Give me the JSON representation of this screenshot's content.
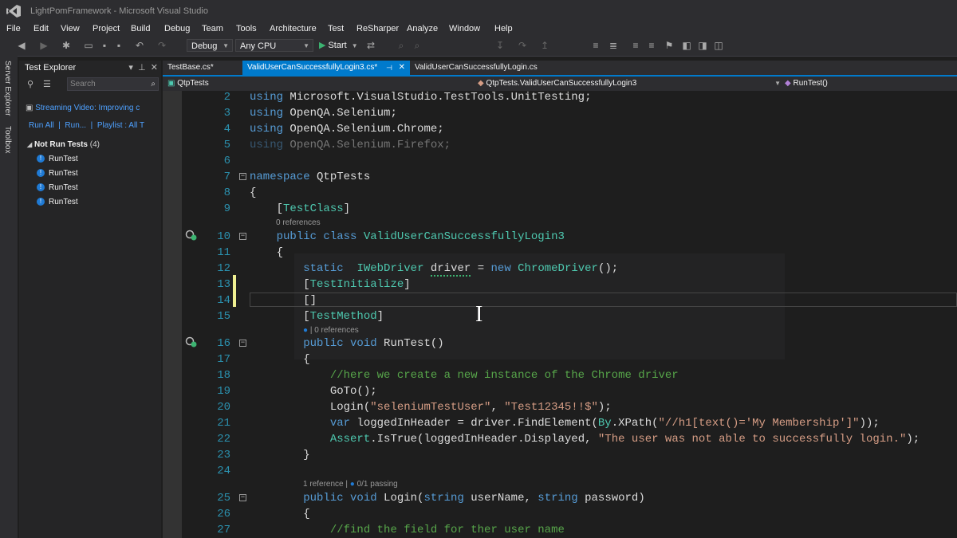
{
  "window": {
    "title": "LightPomFramework - Microsoft Visual Studio"
  },
  "menu": [
    "File",
    "Edit",
    "View",
    "Project",
    "Build",
    "Debug",
    "Team",
    "Tools",
    "Architecture",
    "Test",
    "ReSharper",
    "Analyze",
    "Window",
    "Help"
  ],
  "toolbar": {
    "configuration": "Debug",
    "platform": "Any CPU",
    "start_label": "Start"
  },
  "side_tabs": [
    "Server Explorer",
    "Toolbox"
  ],
  "test_explorer": {
    "title": "Test Explorer",
    "search_placeholder": "Search",
    "streaming": "Streaming Video: Improving c",
    "actions": {
      "run_all": "Run All",
      "run": "Run...",
      "playlist": "Playlist : All T"
    },
    "group_label": "Not Run Tests",
    "group_count": "(4)",
    "tests": [
      "RunTest",
      "RunTest",
      "RunTest",
      "RunTest"
    ]
  },
  "tabs": [
    {
      "label": "TestBase.cs*",
      "active": false
    },
    {
      "label": "ValidUserCanSuccessfullyLogin3.cs*",
      "active": true
    },
    {
      "label": "ValidUserCanSuccessfullyLogin.cs",
      "active": false
    }
  ],
  "navbar": {
    "project": "QtpTests",
    "type": "QtpTests.ValidUserCanSuccessfullyLogin3",
    "member": "RunTest()"
  },
  "lens": {
    "class_refs": "0 references",
    "method_refs": "0 references",
    "login_refs": "1 reference",
    "login_passing": "0/1 passing"
  },
  "code": [
    {
      "n": "2",
      "t": "using Microsoft.VisualStudio.TestTools.UnitTesting;"
    },
    {
      "n": "3",
      "t": "using OpenQA.Selenium;"
    },
    {
      "n": "4",
      "t": "using OpenQA.Selenium.Chrome;"
    },
    {
      "n": "5",
      "t": "using OpenQA.Selenium.Firefox;"
    },
    {
      "n": "6",
      "t": ""
    },
    {
      "n": "7",
      "t": "namespace QtpTests"
    },
    {
      "n": "8",
      "t": "{"
    },
    {
      "n": "9",
      "t": "    [TestClass]"
    },
    {
      "n": "10",
      "t": "    public class ValidUserCanSuccessfullyLogin3"
    },
    {
      "n": "11",
      "t": "    {"
    },
    {
      "n": "12",
      "t": "        static  IWebDriver driver = new ChromeDriver();"
    },
    {
      "n": "13",
      "t": "        [TestInitialize]"
    },
    {
      "n": "14",
      "t": "        []"
    },
    {
      "n": "15",
      "t": "        [TestMethod]"
    },
    {
      "n": "16",
      "t": "        public void RunTest()"
    },
    {
      "n": "17",
      "t": "        {"
    },
    {
      "n": "18",
      "t": "            //here we create a new instance of the Chrome driver"
    },
    {
      "n": "19",
      "t": "            GoTo();"
    },
    {
      "n": "20",
      "t": "            Login(\"seleniumTestUser\", \"Test12345!!$\");"
    },
    {
      "n": "21",
      "t": "            var loggedInHeader = driver.FindElement(By.XPath(\"//h1[text()='My Membership']\"));"
    },
    {
      "n": "22",
      "t": "            Assert.IsTrue(loggedInHeader.Displayed, \"The user was not able to successfully login.\");"
    },
    {
      "n": "23",
      "t": "        }"
    },
    {
      "n": "24",
      "t": ""
    },
    {
      "n": "25",
      "t": "        public void Login(string userName, string password)"
    },
    {
      "n": "26",
      "t": "        {"
    },
    {
      "n": "27",
      "t": "            //find the field for ther user name"
    }
  ],
  "colors": {
    "accent": "#007acc",
    "keyword": "#569cd6",
    "type": "#4ec9b0",
    "string": "#d69d85",
    "comment": "#57a64a",
    "line_number": "#2b91af"
  }
}
